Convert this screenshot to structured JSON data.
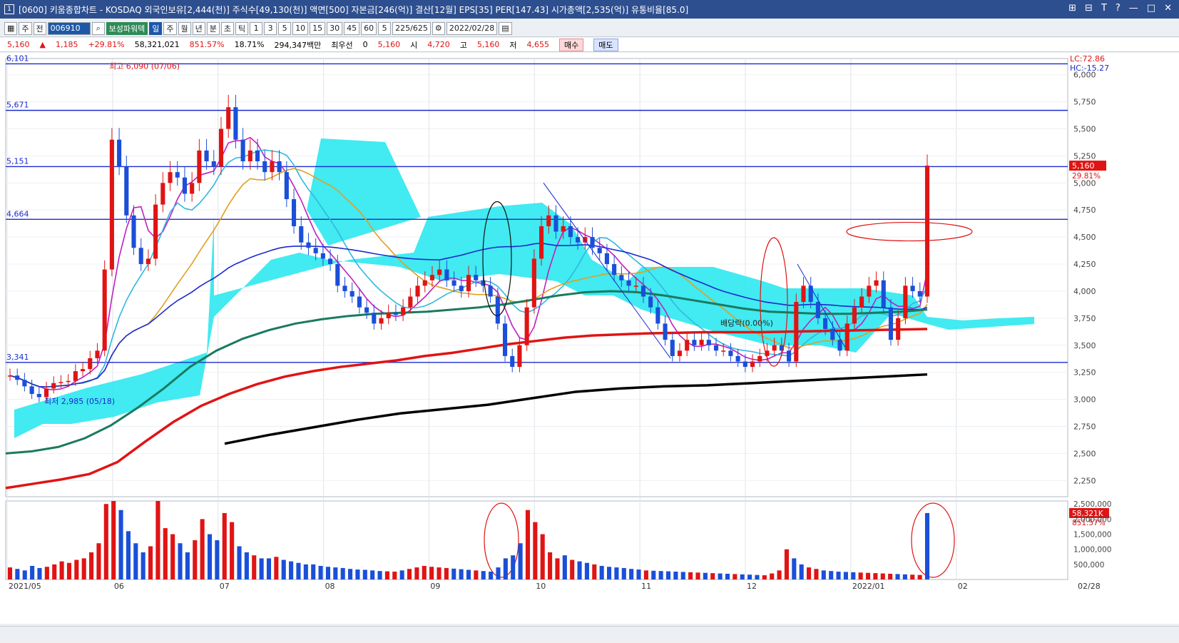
{
  "window": {
    "title": "[0600] 키움종합차트 - KOSDAQ 외국인보유[2,444(천)] 주식수[49,130(천)] 액면[500] 자본금[246(억)] 결산[12월] EPS[35] PER[147.43] 시가총액[2,535(억)] 유통비율[85.0]",
    "window_number": "1",
    "controls": [
      "⊞",
      "⊟",
      "T",
      "?",
      "—",
      "□",
      "✕"
    ]
  },
  "toolbar": {
    "stock_type": "주",
    "prev": "전",
    "code": "006910",
    "broker_label": "보성파워텍",
    "periods": [
      "일",
      "주",
      "월",
      "년",
      "분",
      "초",
      "틱"
    ],
    "numbers": [
      "1",
      "3",
      "5",
      "10",
      "15",
      "30",
      "45",
      "60"
    ],
    "period_count": "5",
    "range": "225/625",
    "date": "2022/02/28"
  },
  "quote": {
    "price": "5,160",
    "arrow": "▲",
    "change": "1,185",
    "change_pct": "+29.81%",
    "volume": "58,321,021",
    "vol_ratio": "851.57%",
    "turnover": "18.71%",
    "amount": "294,347백만",
    "priority_label": "최우선",
    "priority_value": "0",
    "last": "5,160",
    "open_label": "시",
    "open": "4,720",
    "high_label": "고",
    "high": "5,160",
    "low_label": "저",
    "low": "4,655",
    "buy": "매수",
    "sell": "매도"
  },
  "chart_data": {
    "type": "line",
    "price_axis": {
      "ylim": [
        2100,
        6150
      ],
      "ticks": [
        "6,000",
        "5,750",
        "5,500",
        "5,250",
        "5,000",
        "4,750",
        "4,500",
        "4,250",
        "4,000",
        "3,750",
        "3,500",
        "3,250",
        "3,000",
        "2,750",
        "2,500",
        "2,250"
      ],
      "tick_values": [
        6000,
        5750,
        5500,
        5250,
        5000,
        4750,
        4500,
        4250,
        4000,
        3750,
        3500,
        3250,
        3000,
        2750,
        2500,
        2250
      ]
    },
    "volume_axis": {
      "ylim": [
        0,
        2600000
      ],
      "ticks": [
        "2,500,000",
        "2,000,000",
        "1,500,000",
        "1,000,000",
        "500,000"
      ],
      "tick_values": [
        2500000,
        2000000,
        1500000,
        1000000,
        500000
      ]
    },
    "x_labels": [
      "2021/05",
      "06",
      "07",
      "08",
      "09",
      "10",
      "11",
      "12",
      "2022/01",
      "02",
      "02/28"
    ],
    "horizontal_levels": [
      {
        "label": "6,101",
        "value": 6101
      },
      {
        "label": "5,671",
        "value": 5671
      },
      {
        "label": "5,151",
        "value": 5151
      },
      {
        "label": "4,664",
        "value": 4664
      },
      {
        "label": "3,341",
        "value": 3341
      }
    ],
    "annotations": {
      "high": "최고 6,090 (07/06)",
      "low": "최저 2,985 (05/18)",
      "dividend": "배당락(0.00%)",
      "lc": "LC:72.86",
      "hc": "HC:-15.27",
      "last_price": "5,160",
      "last_pct": "29.81%",
      "last_volume": "58,321K",
      "last_vol_pct": "851.57%"
    },
    "close": [
      3220,
      3180,
      3120,
      3050,
      3020,
      3100,
      3150,
      3160,
      3170,
      3260,
      3280,
      3380,
      3450,
      4200,
      5400,
      5150,
      4700,
      4400,
      4250,
      4300,
      4800,
      5000,
      5100,
      5050,
      4900,
      5000,
      5300,
      5200,
      5150,
      5500,
      5700,
      5400,
      5200,
      5300,
      5200,
      5100,
      5200,
      5100,
      4850,
      4600,
      4450,
      4400,
      4350,
      4300,
      4250,
      4050,
      4000,
      3950,
      3850,
      3800,
      3700,
      3750,
      3800,
      3780,
      3850,
      3950,
      4050,
      4100,
      4150,
      4200,
      4100,
      4050,
      4000,
      4150,
      4100,
      4050,
      3950,
      3700,
      3400,
      3300,
      3500,
      3850,
      4300,
      4600,
      4700,
      4550,
      4600,
      4500,
      4450,
      4500,
      4400,
      4350,
      4250,
      4150,
      4100,
      4050,
      4050,
      3950,
      3850,
      3700,
      3550,
      3400,
      3450,
      3550,
      3500,
      3550,
      3500,
      3450,
      3450,
      3400,
      3350,
      3300,
      3350,
      3400,
      3450,
      3500,
      3450,
      3350,
      3900,
      4050,
      3900,
      3750,
      3650,
      3550,
      3450,
      3700,
      3850,
      3950,
      4050,
      4100,
      3850,
      3550,
      3750,
      4050,
      4000,
      3950,
      5160
    ],
    "series": [
      {
        "name": "MA5",
        "color": "#c020c0"
      },
      {
        "name": "MA10",
        "color": "#30b8e0"
      },
      {
        "name": "MA20",
        "color": "#e0a020"
      },
      {
        "name": "MA60",
        "color": "#1a2ad0"
      },
      {
        "name": "MA120",
        "color": "#1a7a60"
      },
      {
        "name": "MA240",
        "color": "#e01414"
      },
      {
        "name": "MA480",
        "color": "#000000"
      }
    ],
    "ma120": [
      2500,
      2520,
      2560,
      2640,
      2760,
      2920,
      3100,
      3300,
      3450,
      3560,
      3640,
      3700,
      3740,
      3770,
      3790,
      3800,
      3810,
      3830,
      3850,
      3880,
      3920,
      3960,
      3990,
      4000,
      3990,
      3960,
      3920,
      3880,
      3840,
      3810,
      3800,
      3790,
      3790,
      3800,
      3810,
      3830
    ],
    "ma240": [
      2180,
      2220,
      2260,
      2310,
      2420,
      2610,
      2790,
      2940,
      3050,
      3140,
      3210,
      3260,
      3300,
      3330,
      3360,
      3400,
      3430,
      3470,
      3510,
      3540,
      3570,
      3590,
      3600,
      3610,
      3615,
      3620,
      3620,
      3620,
      3625,
      3630,
      3635,
      3640,
      3645,
      3650
    ],
    "ma480": [
      2590,
      2670,
      2740,
      2810,
      2870,
      2910,
      2950,
      3010,
      3070,
      3100,
      3120,
      3130,
      3150,
      3170,
      3190,
      3210,
      3230
    ],
    "volume": [
      400000,
      350000,
      300000,
      450000,
      380000,
      420000,
      500000,
      600000,
      550000,
      650000,
      700000,
      900000,
      1200000,
      2500000,
      2600000,
      2300000,
      1600000,
      1200000,
      900000,
      1100000,
      2600000,
      1700000,
      1500000,
      1200000,
      900000,
      1300000,
      2000000,
      1500000,
      1300000,
      2200000,
      1900000,
      1100000,
      900000,
      800000,
      700000,
      700000,
      750000,
      650000,
      600000,
      550000,
      500000,
      500000,
      450000,
      420000,
      400000,
      380000,
      350000,
      330000,
      320000,
      300000,
      280000,
      270000,
      260000,
      300000,
      350000,
      400000,
      450000,
      420000,
      400000,
      380000,
      360000,
      340000,
      320000,
      300000,
      280000,
      260000,
      400000,
      700000,
      800000,
      1200000,
      2300000,
      1900000,
      1500000,
      900000,
      700000,
      800000,
      650000,
      600000,
      550000,
      500000,
      450000,
      420000,
      400000,
      380000,
      350000,
      330000,
      300000,
      290000,
      280000,
      270000,
      260000,
      250000,
      240000,
      230000,
      220000,
      210000,
      200000,
      190000,
      180000,
      170000,
      160000,
      150000,
      140000,
      200000,
      300000,
      1000000,
      700000,
      500000,
      400000,
      350000,
      300000,
      280000,
      260000,
      250000,
      240000,
      230000,
      220000,
      210000,
      200000,
      190000,
      180000,
      170000,
      160000,
      150000,
      2200000
    ]
  }
}
